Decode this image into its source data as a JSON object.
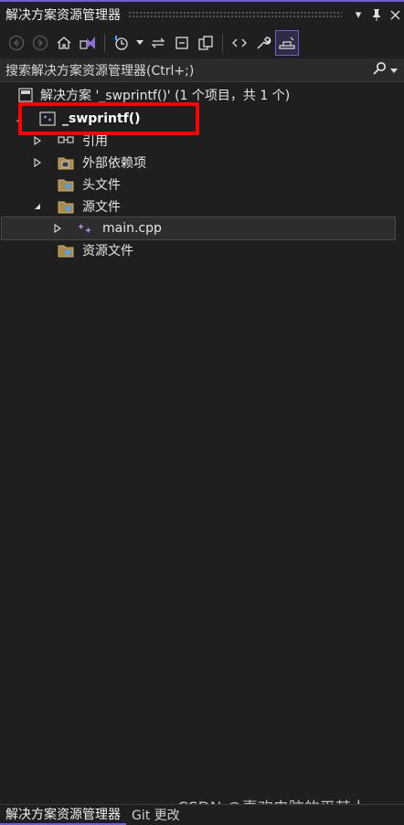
{
  "window": {
    "title": "解决方案资源管理器"
  },
  "search": {
    "placeholder": "搜索解决方案资源管理器(Ctrl+;)"
  },
  "tree": {
    "solution": "解决方案 '_swprintf()' (1 个项目，共 1 个)",
    "project": "_swprintf()",
    "references": "引用",
    "external_deps": "外部依赖项",
    "headers": "头文件",
    "sources": "源文件",
    "source_file": "main.cpp",
    "resources": "资源文件"
  },
  "bottom_tabs": [
    {
      "label": "解决方案资源管理器",
      "active": true
    },
    {
      "label": "Git 更改",
      "active": false
    }
  ],
  "watermark": "CSDN @喜欢电脑的平某人",
  "colors": {
    "accent": "#6b5fd3",
    "highlight": "#ff0000",
    "background": "#1f1f1f"
  }
}
